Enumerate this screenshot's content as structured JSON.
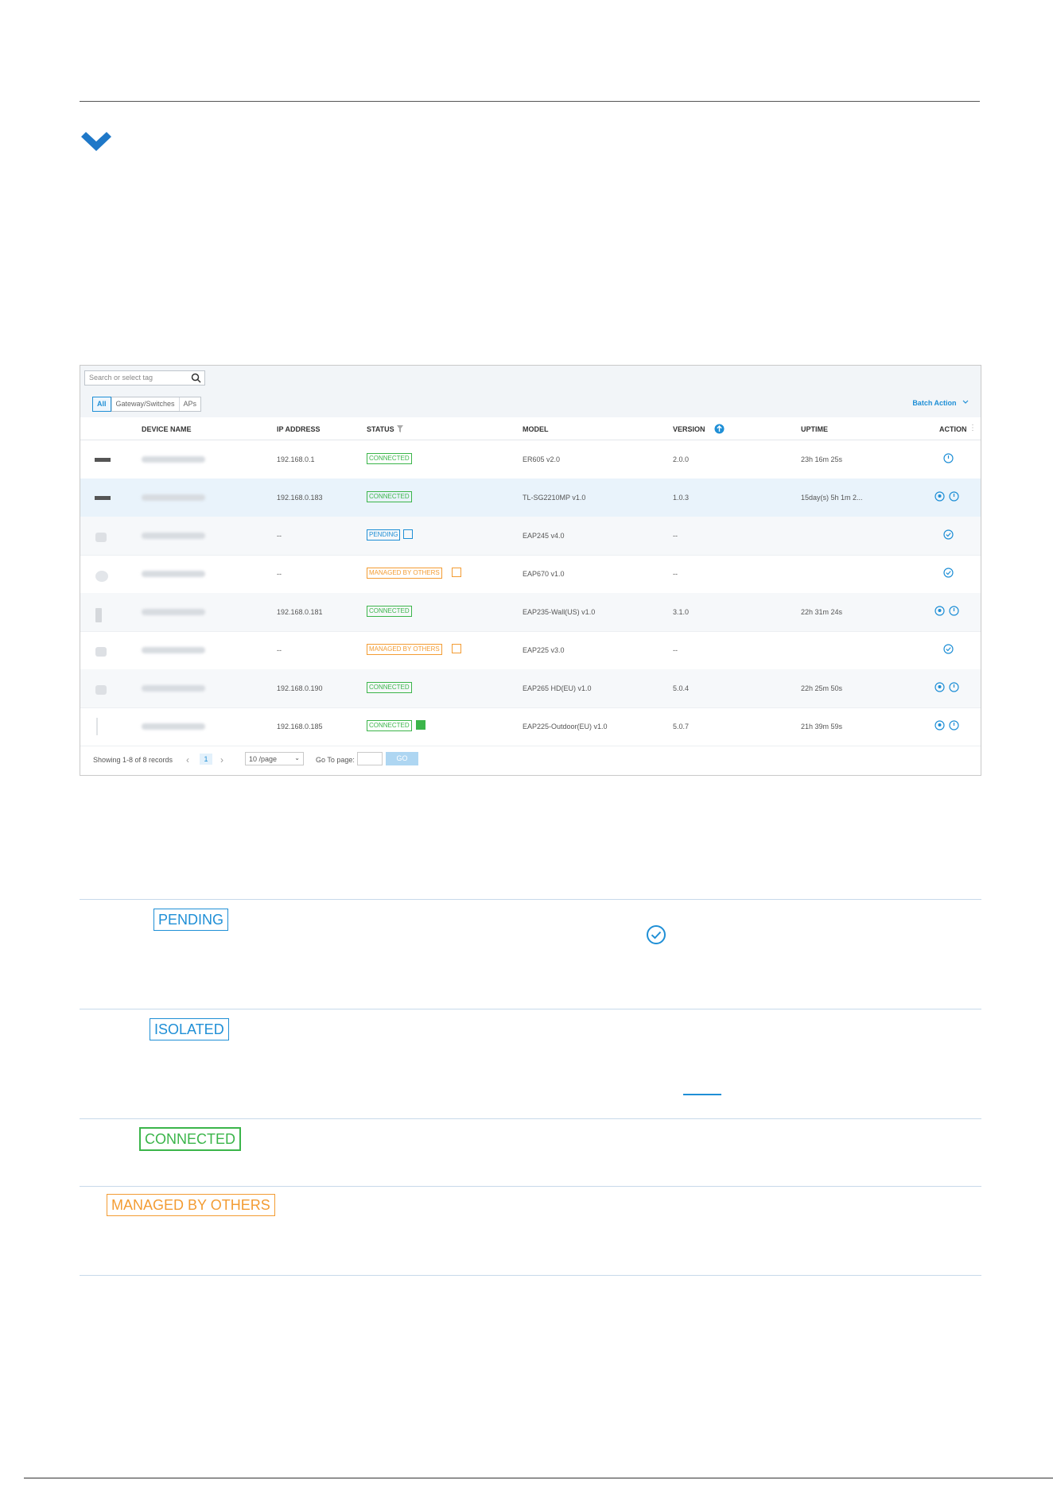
{
  "toolbar": {
    "search_placeholder": "Search or select tag",
    "filters": [
      "All",
      "Gateway/Switches",
      "APs"
    ],
    "batch_action": "Batch Action"
  },
  "columns": [
    "DEVICE NAME",
    "IP ADDRESS",
    "STATUS",
    "MODEL",
    "VERSION",
    "UPTIME",
    "ACTION"
  ],
  "rows": [
    {
      "ip": "192.168.0.1",
      "status": "CONNECTED",
      "model": "ER605 v2.0",
      "version": "2.0.0",
      "uptime": "23h 16m 25s"
    },
    {
      "ip": "192.168.0.183",
      "status": "CONNECTED",
      "model": "TL-SG2210MP v1.0",
      "version": "1.0.3",
      "uptime": "15day(s) 5h 1m 2..."
    },
    {
      "ip": "--",
      "status": "PENDING",
      "model": "EAP245 v4.0",
      "version": "--",
      "uptime": ""
    },
    {
      "ip": "--",
      "status": "MANAGED BY OTHERS",
      "model": "EAP670 v1.0",
      "version": "--",
      "uptime": ""
    },
    {
      "ip": "192.168.0.181",
      "status": "CONNECTED",
      "model": "EAP235-Wall(US) v1.0",
      "version": "3.1.0",
      "uptime": "22h 31m 24s"
    },
    {
      "ip": "--",
      "status": "MANAGED BY OTHERS",
      "model": "EAP225 v3.0",
      "version": "--",
      "uptime": ""
    },
    {
      "ip": "192.168.0.190",
      "status": "CONNECTED",
      "model": "EAP265 HD(EU) v1.0",
      "version": "5.0.4",
      "uptime": "22h 25m 50s"
    },
    {
      "ip": "192.168.0.185",
      "status": "CONNECTED",
      "model": "EAP225-Outdoor(EU) v1.0",
      "version": "5.0.7",
      "uptime": "21h 39m 59s"
    }
  ],
  "pager": {
    "showing": "Showing 1-8 of 8 records",
    "page": "1",
    "per_page": "10 /page",
    "goto": "Go To page:",
    "go": "GO"
  },
  "legend": [
    "PENDING",
    "ISOLATED",
    "CONNECTED",
    "MANAGED BY OTHERS"
  ],
  "colors": {
    "blue": "#1f8fd6",
    "green": "#3bb54a",
    "orange": "#f39c33"
  }
}
